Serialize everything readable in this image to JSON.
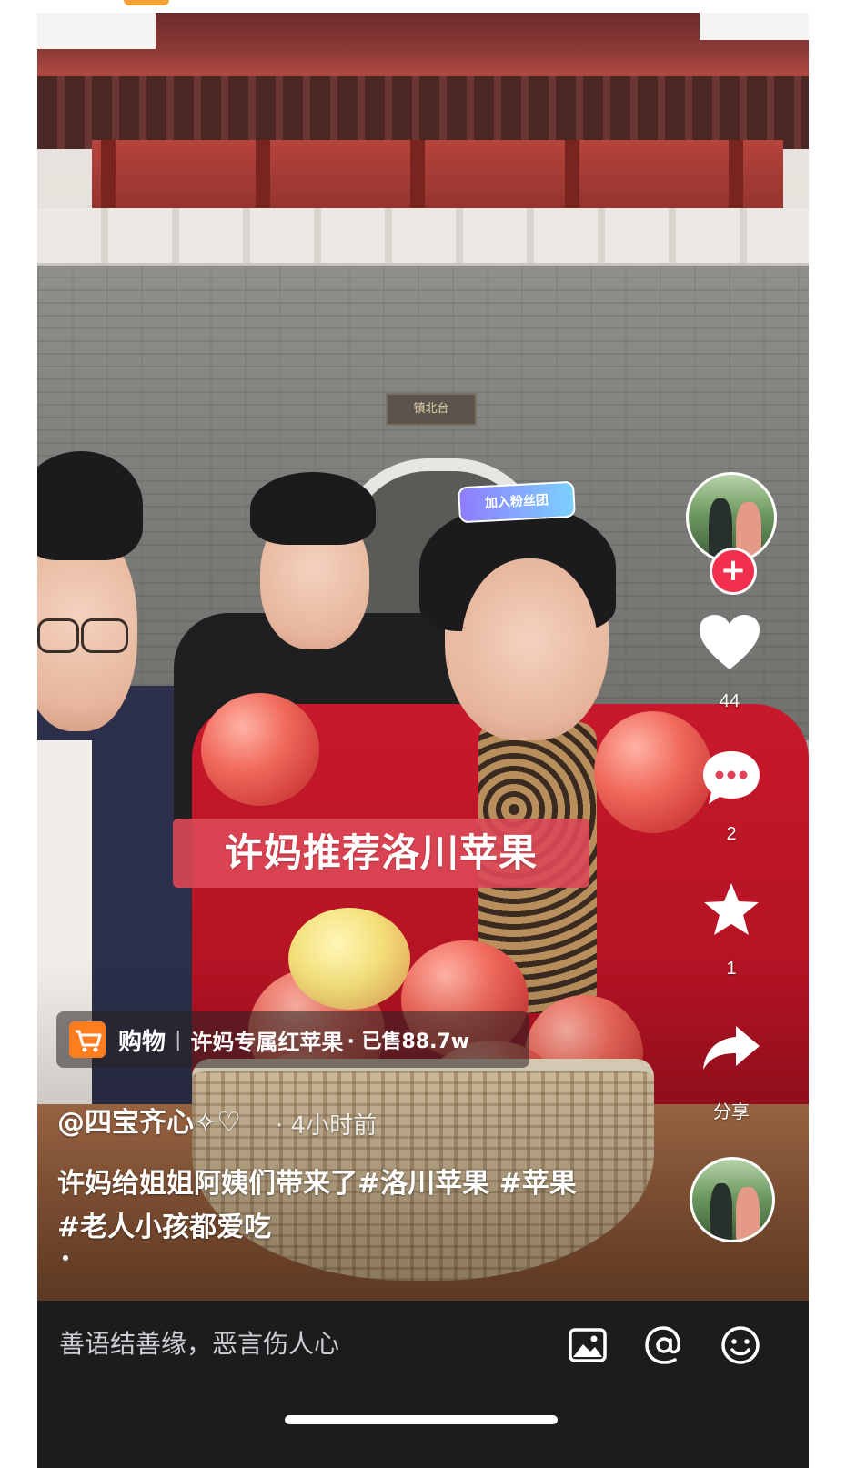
{
  "video": {
    "plaque_text": "镇北台",
    "fan_badge": "加入粉丝团",
    "caption": "许妈推荐洛川苹果"
  },
  "right_rail": {
    "follow_icon": "plus-icon",
    "like_icon": "heart-icon",
    "like_count": "44",
    "comment_icon": "comment-icon",
    "comment_count": "2",
    "favorite_icon": "star-icon",
    "favorite_count": "1",
    "share_icon": "share-icon",
    "share_label": "分享",
    "music_icon": "music-disc-icon"
  },
  "shopping": {
    "icon": "cart-icon",
    "label": "购物",
    "separator": "|",
    "product_title": "许妈专属红苹果",
    "sold": "· 已售88.7w"
  },
  "post": {
    "author": "@四宝齐心✧♡",
    "time_ago": "· 4小时前",
    "description_line1": "许妈给姐姐阿姨们带来了#洛川苹果 #苹果",
    "description_line2": "#老人小孩都爱吃"
  },
  "comment_bar": {
    "placeholder": "善语结善缘，恶言伤人心",
    "image_icon": "image-icon",
    "mention_icon": "at-icon",
    "emoji_icon": "emoji-icon"
  },
  "colors": {
    "caption_bg": "#dd4856",
    "follow_red": "#f2304d",
    "shop_orange": "#ff7d1e",
    "bar_bg": "#1c1c1e"
  }
}
